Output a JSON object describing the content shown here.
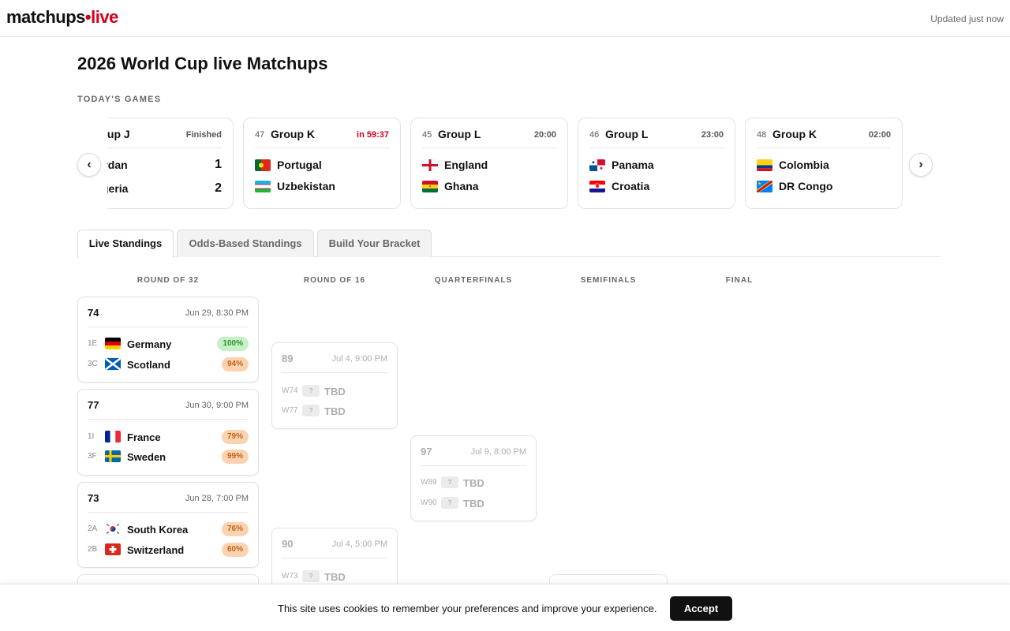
{
  "header": {
    "logo_main": "matchups",
    "logo_dot": "•",
    "logo_live": "live",
    "updated": "Updated just now"
  },
  "page": {
    "title": "2026 World Cup live Matchups",
    "todays_games_label": "TODAY'S GAMES"
  },
  "carousel": {
    "prev_label": "‹",
    "next_label": "›",
    "games": [
      {
        "num": "",
        "group": "Group J",
        "status": "Finished",
        "live": false,
        "home": {
          "name": "Jordan",
          "score": "1",
          "flag": "none"
        },
        "away": {
          "name": "Algeria",
          "score": "2",
          "flag": "none"
        }
      },
      {
        "num": "47",
        "group": "Group K",
        "status": "in 59:37",
        "live": true,
        "home": {
          "name": "Portugal",
          "score": "",
          "flag": "portugal"
        },
        "away": {
          "name": "Uzbekistan",
          "score": "",
          "flag": "uzbekistan"
        }
      },
      {
        "num": "45",
        "group": "Group L",
        "status": "20:00",
        "live": false,
        "home": {
          "name": "England",
          "score": "",
          "flag": "england"
        },
        "away": {
          "name": "Ghana",
          "score": "",
          "flag": "ghana"
        }
      },
      {
        "num": "46",
        "group": "Group L",
        "status": "23:00",
        "live": false,
        "home": {
          "name": "Panama",
          "score": "",
          "flag": "panama"
        },
        "away": {
          "name": "Croatia",
          "score": "",
          "flag": "croatia"
        }
      },
      {
        "num": "48",
        "group": "Group K",
        "status": "02:00",
        "live": false,
        "home": {
          "name": "Colombia",
          "score": "",
          "flag": "colombia"
        },
        "away": {
          "name": "DR Congo",
          "score": "",
          "flag": "drcongo"
        }
      }
    ]
  },
  "tabs": [
    {
      "label": "Live Standings",
      "active": true
    },
    {
      "label": "Odds-Based Standings",
      "active": false
    },
    {
      "label": "Build Your Bracket",
      "active": false
    }
  ],
  "bracket": {
    "rounds": [
      "ROUND OF 32",
      "ROUND OF 16",
      "QUARTERFINALS",
      "SEMIFINALS",
      "FINAL"
    ],
    "r32": [
      {
        "num": "74",
        "date": "Jun 29, 8:30 PM",
        "teams": [
          {
            "seed": "1E",
            "name": "Germany",
            "flag": "germany",
            "pct": "100%",
            "tone": "green"
          },
          {
            "seed": "3C",
            "name": "Scotland",
            "flag": "scotland",
            "pct": "94%",
            "tone": "orange"
          }
        ]
      },
      {
        "num": "77",
        "date": "Jun 30, 9:00 PM",
        "teams": [
          {
            "seed": "1I",
            "name": "France",
            "flag": "france",
            "pct": "79%",
            "tone": "orange"
          },
          {
            "seed": "3F",
            "name": "Sweden",
            "flag": "sweden",
            "pct": "99%",
            "tone": "orange"
          }
        ]
      },
      {
        "num": "73",
        "date": "Jun 28, 7:00 PM",
        "teams": [
          {
            "seed": "2A",
            "name": "South Korea",
            "flag": "southkorea",
            "pct": "76%",
            "tone": "orange"
          },
          {
            "seed": "2B",
            "name": "Switzerland",
            "flag": "switzerland",
            "pct": "60%",
            "tone": "orange"
          }
        ]
      }
    ],
    "r16": [
      {
        "num": "89",
        "date": "Jul 4, 9:00 PM",
        "teams": [
          {
            "seed": "W74",
            "q": "?",
            "name": "TBD"
          },
          {
            "seed": "W77",
            "q": "?",
            "name": "TBD"
          }
        ]
      },
      {
        "num": "90",
        "date": "Jul 4, 5:00 PM",
        "teams": [
          {
            "seed": "W73",
            "q": "?",
            "name": "TBD"
          }
        ]
      }
    ],
    "qf": [
      {
        "num": "97",
        "date": "Jul 9, 8:00 PM",
        "teams": [
          {
            "seed": "W89",
            "q": "?",
            "name": "TBD"
          },
          {
            "seed": "W90",
            "q": "?",
            "name": "TBD"
          }
        ]
      }
    ]
  },
  "cookie": {
    "text": "This site uses cookies to remember your preferences and improve your experience.",
    "accept_label": "Accept"
  }
}
